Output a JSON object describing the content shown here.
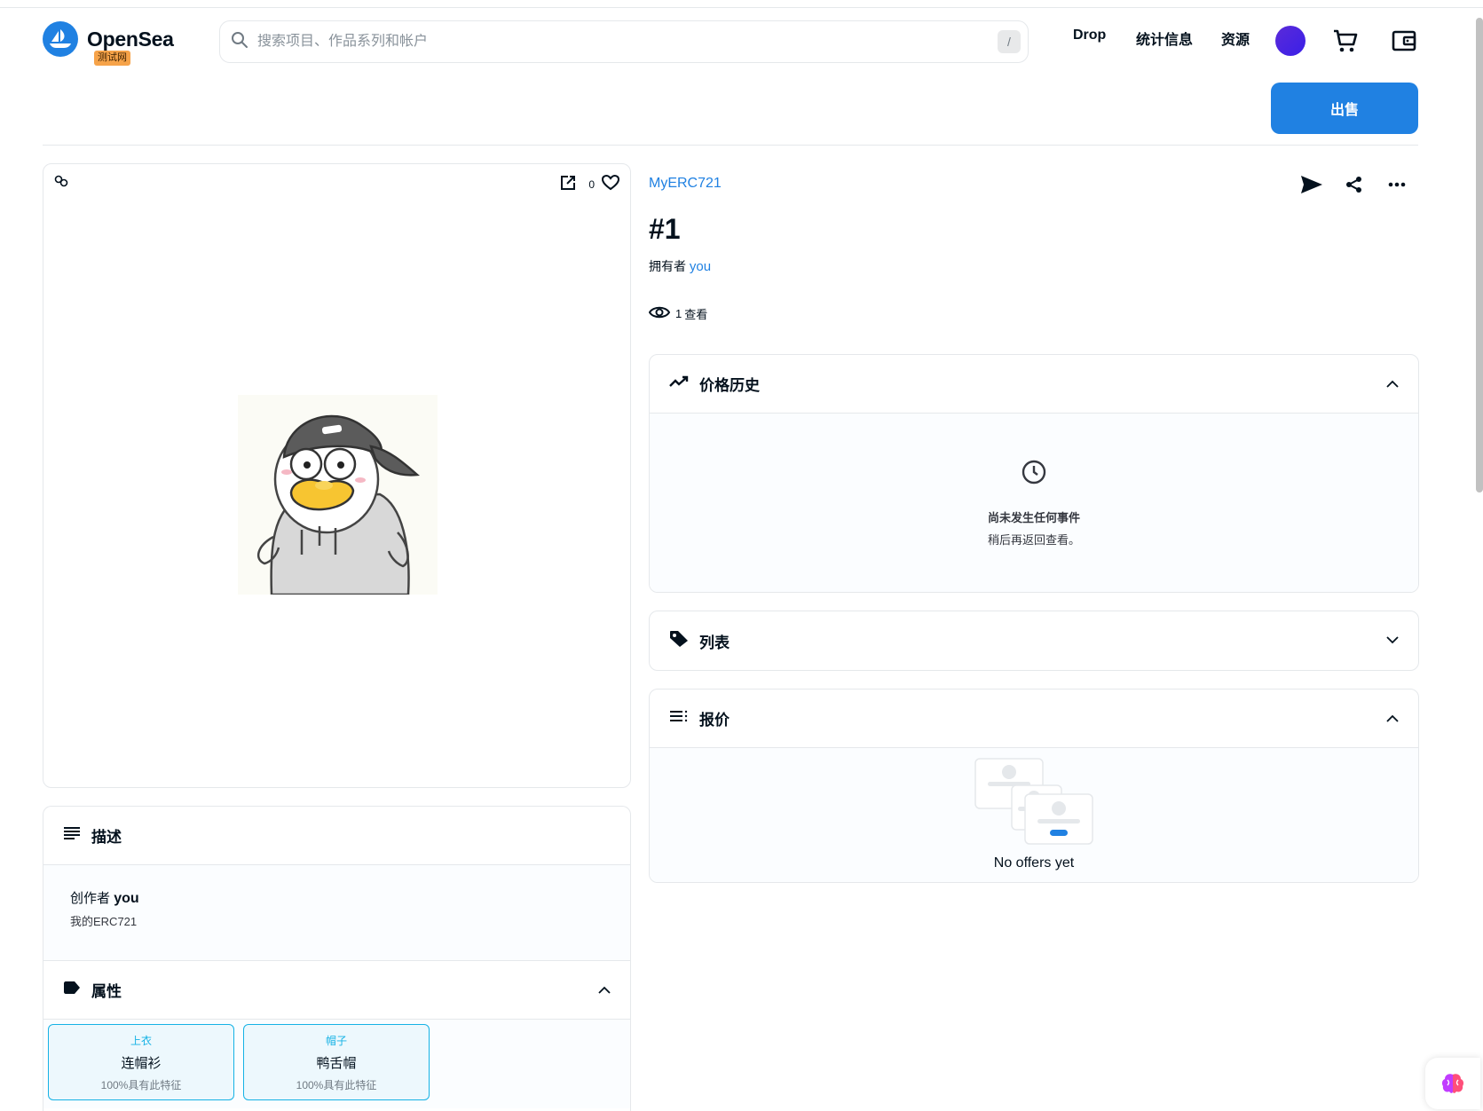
{
  "header": {
    "logo_text": "OpenSea",
    "testnet_badge": "测试网",
    "search_placeholder": "搜索项目、作品系列和帐户",
    "search_shortcut": "/",
    "nav": {
      "drop": "Drop",
      "stats": "统计信息",
      "resources": "资源"
    }
  },
  "actions": {
    "sell_label": "出售"
  },
  "item": {
    "collection": "MyERC721",
    "title": "#1",
    "owner_prefix": "拥有者",
    "owner_name": "you",
    "views_count": "1",
    "views_label": "查看",
    "favorites_count": "0"
  },
  "description": {
    "title": "描述",
    "creator_prefix": "创作者",
    "creator_name": "you",
    "text": "我的ERC721"
  },
  "properties": {
    "title": "属性",
    "traits": [
      {
        "type": "上衣",
        "value": "连帽衫",
        "rarity": "100%具有此特征"
      },
      {
        "type": "帽子",
        "value": "鸭舌帽",
        "rarity": "100%具有此特征"
      }
    ]
  },
  "price_history": {
    "title": "价格历史",
    "empty_title": "尚未发生任何事件",
    "empty_sub": "稍后再返回查看。"
  },
  "listings": {
    "title": "列表"
  },
  "offers": {
    "title": "报价",
    "empty": "No offers yet"
  },
  "colors": {
    "accent": "#2081e2",
    "trait_border": "#15b2e5",
    "badge": "#f6a349"
  }
}
